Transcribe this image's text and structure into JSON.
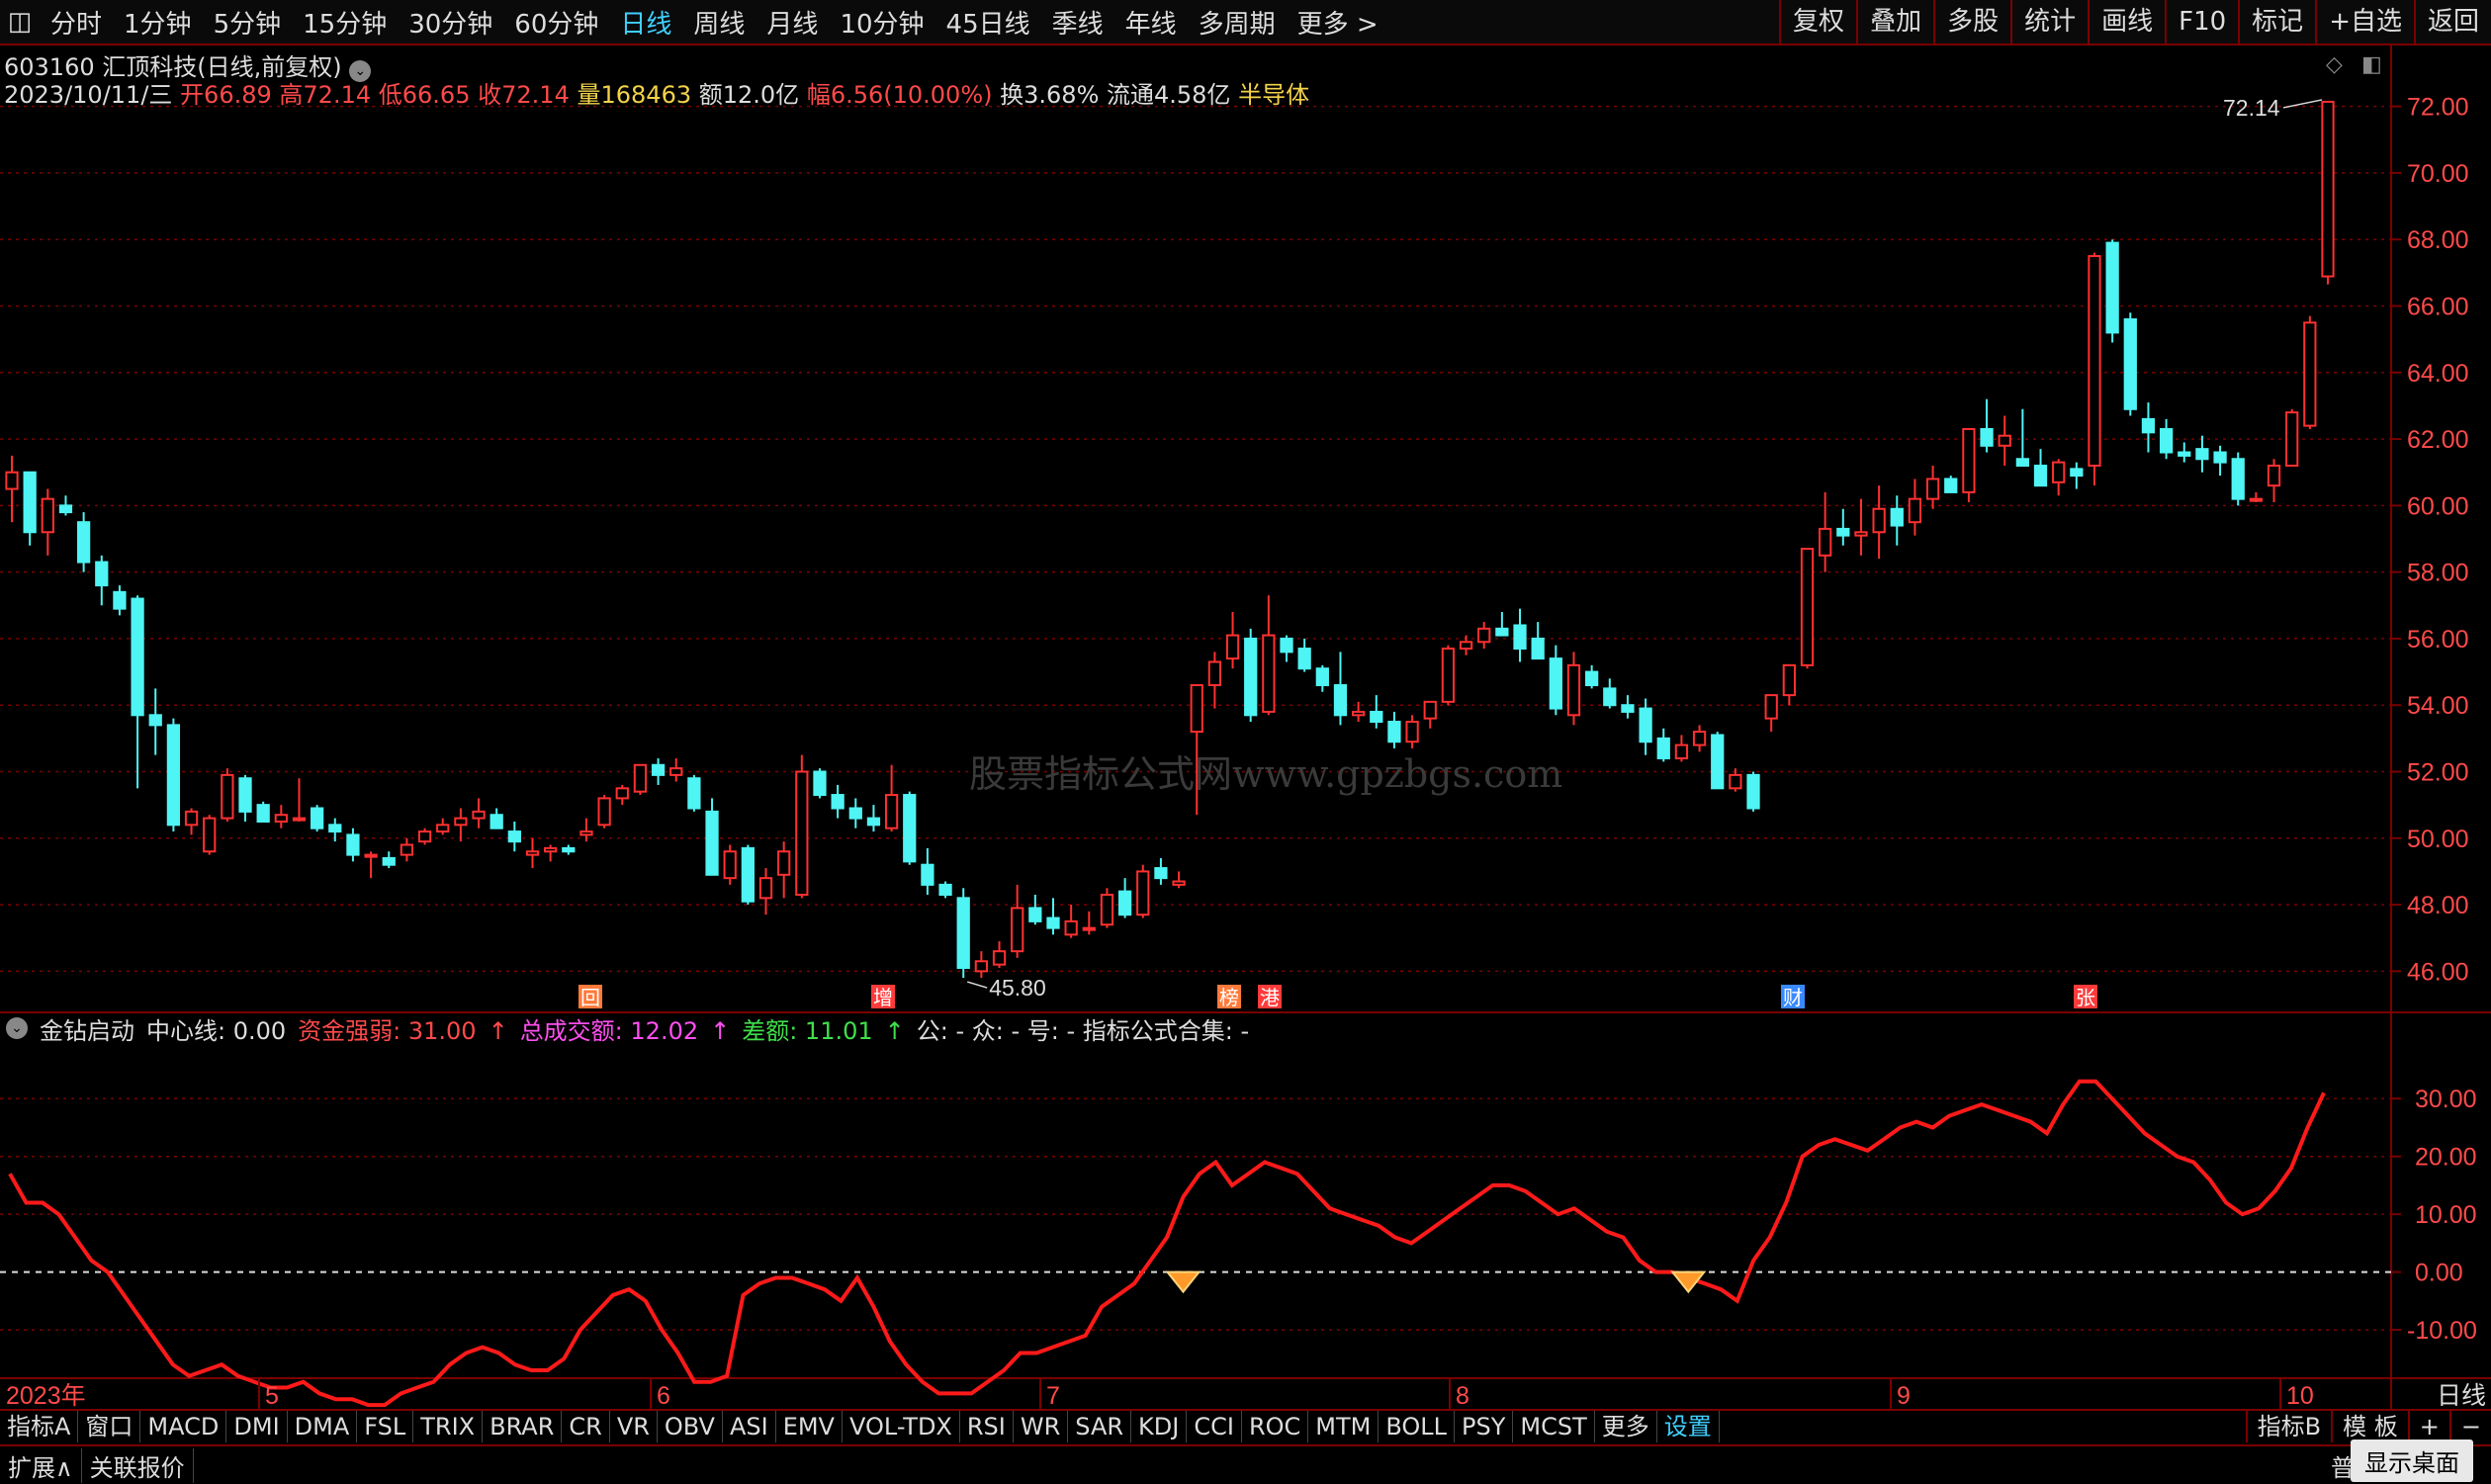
{
  "toolbar": {
    "tabs": [
      "分时",
      "1分钟",
      "5分钟",
      "15分钟",
      "30分钟",
      "60分钟",
      "日线",
      "周线",
      "月线",
      "10分钟",
      "45日线",
      "季线",
      "年线",
      "多周期",
      "更多 >"
    ],
    "active": "日线",
    "right": [
      "复权",
      "叠加",
      "多股",
      "统计",
      "画线",
      "F10",
      "标记",
      "+自选",
      "返回"
    ]
  },
  "stock": {
    "code_name": "603160 汇顶科技(日线,前复权)",
    "line2": [
      [
        "2023/10/11/三 ",
        "c-w"
      ],
      [
        "开",
        "c-r"
      ],
      [
        "66.89",
        "c-r"
      ],
      [
        " 高",
        "c-r"
      ],
      [
        "72.14",
        "c-r"
      ],
      [
        " 低",
        "c-r"
      ],
      [
        "66.65",
        "c-r"
      ],
      [
        " 收",
        "c-r"
      ],
      [
        "72.14",
        "c-r"
      ],
      [
        " 量",
        "c-y"
      ],
      [
        "168463",
        "c-y"
      ],
      [
        " 额12.0亿 ",
        "c-w"
      ],
      [
        "幅",
        "c-r"
      ],
      [
        "6.56(10.00%)",
        "c-r"
      ],
      [
        " 换3.68% 流通4.58亿 ",
        "c-w"
      ],
      [
        "半导体",
        "c-y"
      ]
    ]
  },
  "chart_data": {
    "type": "candlestick",
    "ylim": [
      45,
      73
    ],
    "yticks": [
      "72.00",
      "70.00",
      "68.00",
      "66.00",
      "64.00",
      "62.00",
      "60.00",
      "58.00",
      "56.00",
      "54.00",
      "52.00",
      "50.00",
      "48.00",
      "46.00"
    ],
    "max_label": "72.14",
    "min_label": "45.80",
    "months": [
      "2023年",
      "5",
      "6",
      "7",
      "8",
      "9",
      "10"
    ],
    "markers": [
      "回",
      "增",
      "榜",
      "港",
      "财",
      "张"
    ],
    "ohlc": [
      [
        60.5,
        61.5,
        59.5,
        61
      ],
      [
        61,
        61,
        58.8,
        59.2
      ],
      [
        59.2,
        60.5,
        58.5,
        60.2
      ],
      [
        60,
        60.3,
        59.7,
        59.8
      ],
      [
        59.5,
        59.8,
        58,
        58.3
      ],
      [
        58.3,
        58.5,
        57,
        57.6
      ],
      [
        57.4,
        57.6,
        56.7,
        56.9
      ],
      [
        57.2,
        57.3,
        51.5,
        53.7
      ],
      [
        53.7,
        54.5,
        52.5,
        53.4
      ],
      [
        53.4,
        53.6,
        50.2,
        50.4
      ],
      [
        50.4,
        50.9,
        50.1,
        50.8
      ],
      [
        49.6,
        50.7,
        49.5,
        50.6
      ],
      [
        50.6,
        52.1,
        50.5,
        51.9
      ],
      [
        51.8,
        51.9,
        50.5,
        50.8
      ],
      [
        51,
        51.1,
        50.6,
        50.5
      ],
      [
        50.5,
        51,
        50.3,
        50.7
      ],
      [
        50.6,
        51.8,
        50.5,
        50.6
      ],
      [
        50.9,
        51,
        50.2,
        50.3
      ],
      [
        50.4,
        50.6,
        49.9,
        50.2
      ],
      [
        50.1,
        50.3,
        49.3,
        49.5
      ],
      [
        49.5,
        49.6,
        48.8,
        49.5
      ],
      [
        49.4,
        49.6,
        49.1,
        49.2
      ],
      [
        49.5,
        50,
        49.3,
        49.8
      ],
      [
        49.9,
        50.3,
        49.8,
        50.2
      ],
      [
        50.2,
        50.6,
        50.1,
        50.4
      ],
      [
        50.4,
        50.9,
        49.9,
        50.6
      ],
      [
        50.6,
        51.2,
        50.3,
        50.8
      ],
      [
        50.7,
        50.9,
        50.3,
        50.3
      ],
      [
        50.2,
        50.5,
        49.6,
        49.9
      ],
      [
        49.5,
        50,
        49.1,
        49.6
      ],
      [
        49.6,
        49.8,
        49.3,
        49.7
      ],
      [
        49.7,
        49.8,
        49.5,
        49.6
      ],
      [
        50.1,
        50.6,
        49.9,
        50.2
      ],
      [
        50.4,
        51.3,
        50.3,
        51.2
      ],
      [
        51.2,
        51.6,
        51,
        51.5
      ],
      [
        51.4,
        52.2,
        51.3,
        52.2
      ],
      [
        52.2,
        52.4,
        51.6,
        51.9
      ],
      [
        51.9,
        52.4,
        51.7,
        52.1
      ],
      [
        51.8,
        51.9,
        50.8,
        50.9
      ],
      [
        50.8,
        51.2,
        48.9,
        48.9
      ],
      [
        48.8,
        49.8,
        48.6,
        49.6
      ],
      [
        49.7,
        49.8,
        48,
        48.1
      ],
      [
        48.2,
        49.1,
        47.7,
        48.8
      ],
      [
        48.9,
        49.9,
        48.2,
        49.6
      ],
      [
        48.3,
        52.5,
        48.2,
        52
      ],
      [
        52,
        52.1,
        51.2,
        51.3
      ],
      [
        51.3,
        51.6,
        50.6,
        50.9
      ],
      [
        50.9,
        51.2,
        50.3,
        50.6
      ],
      [
        50.6,
        51,
        50.2,
        50.4
      ],
      [
        50.3,
        52.2,
        50.2,
        51.3
      ],
      [
        51.3,
        51.4,
        49.2,
        49.3
      ],
      [
        49.2,
        49.7,
        48.3,
        48.6
      ],
      [
        48.6,
        48.7,
        48.2,
        48.3
      ],
      [
        48.2,
        48.5,
        45.8,
        46.1
      ],
      [
        46,
        46.6,
        45.8,
        46.3
      ],
      [
        46.2,
        46.9,
        46.1,
        46.6
      ],
      [
        46.6,
        48.6,
        46.4,
        47.9
      ],
      [
        47.9,
        48.3,
        47.4,
        47.5
      ],
      [
        47.6,
        48.2,
        47.1,
        47.3
      ],
      [
        47.1,
        48,
        47,
        47.5
      ],
      [
        47.3,
        47.8,
        47.1,
        47.3
      ],
      [
        47.4,
        48.5,
        47.3,
        48.3
      ],
      [
        48.4,
        48.8,
        47.6,
        47.7
      ],
      [
        47.7,
        49.2,
        47.6,
        49
      ],
      [
        49.1,
        49.4,
        48.6,
        48.8
      ],
      [
        48.6,
        49,
        48.5,
        48.7
      ],
      [
        53.2,
        54.5,
        50.7,
        54.6
      ],
      [
        54.6,
        55.6,
        53.9,
        55.3
      ],
      [
        55.4,
        56.8,
        55.1,
        56.1
      ],
      [
        56,
        56.3,
        53.5,
        53.7
      ],
      [
        53.8,
        57.3,
        53.7,
        56.1
      ],
      [
        56,
        56.1,
        55.3,
        55.6
      ],
      [
        55.7,
        56,
        55,
        55.1
      ],
      [
        55.1,
        55.2,
        54.4,
        54.6
      ],
      [
        54.6,
        55.6,
        53.4,
        53.7
      ],
      [
        53.7,
        54.1,
        53.5,
        53.8
      ],
      [
        53.8,
        54.3,
        53.3,
        53.5
      ],
      [
        53.5,
        53.8,
        52.7,
        52.9
      ],
      [
        52.9,
        53.7,
        52.7,
        53.5
      ],
      [
        53.6,
        54.1,
        53.3,
        54.1
      ],
      [
        54.1,
        55.8,
        54,
        55.7
      ],
      [
        55.7,
        56.1,
        55.5,
        55.9
      ],
      [
        55.9,
        56.5,
        55.7,
        56.3
      ],
      [
        56.3,
        56.8,
        56.1,
        56.1
      ],
      [
        56.4,
        56.9,
        55.3,
        55.7
      ],
      [
        56,
        56.5,
        55.8,
        55.4
      ],
      [
        55.4,
        55.8,
        53.7,
        53.9
      ],
      [
        53.7,
        55.6,
        53.4,
        55.2
      ],
      [
        55,
        55.2,
        54.5,
        54.6
      ],
      [
        54.5,
        54.8,
        53.9,
        54
      ],
      [
        54,
        54.3,
        53.6,
        53.8
      ],
      [
        53.9,
        54.2,
        52.5,
        52.9
      ],
      [
        53,
        53.3,
        52.3,
        52.4
      ],
      [
        52.4,
        53.1,
        52.3,
        52.8
      ],
      [
        52.8,
        53.4,
        52.6,
        53.2
      ],
      [
        53.1,
        53.2,
        51.5,
        51.5
      ],
      [
        51.5,
        52.1,
        51.4,
        51.9
      ],
      [
        51.9,
        52,
        50.8,
        50.9
      ],
      [
        53.6,
        54.3,
        53.2,
        54.3
      ],
      [
        54.3,
        55.2,
        54,
        55.2
      ],
      [
        55.2,
        58.2,
        55.1,
        58.7
      ],
      [
        58.5,
        60.4,
        58,
        59.3
      ],
      [
        59.3,
        59.9,
        58.8,
        59.1
      ],
      [
        59.1,
        60.2,
        58.5,
        59.2
      ],
      [
        59.2,
        60.6,
        58.4,
        59.9
      ],
      [
        59.9,
        60.3,
        58.8,
        59.4
      ],
      [
        59.5,
        60.8,
        59.1,
        60.2
      ],
      [
        60.2,
        61.2,
        59.9,
        60.8
      ],
      [
        60.8,
        60.9,
        60.4,
        60.4
      ],
      [
        60.4,
        62.3,
        60.1,
        62.3
      ],
      [
        62.3,
        63.2,
        61.6,
        61.8
      ],
      [
        61.8,
        62.7,
        61.2,
        62.1
      ],
      [
        61.4,
        62.9,
        61.2,
        61.2
      ],
      [
        61.2,
        61.7,
        60.8,
        60.6
      ],
      [
        60.7,
        61.4,
        60.3,
        61.3
      ],
      [
        61.1,
        61.3,
        60.5,
        60.9
      ],
      [
        61.2,
        67.6,
        60.6,
        67.5
      ],
      [
        67.9,
        68,
        64.9,
        65.2
      ],
      [
        65.6,
        65.8,
        62.7,
        62.9
      ],
      [
        62.6,
        63.1,
        61.6,
        62.2
      ],
      [
        62.3,
        62.6,
        61.4,
        61.6
      ],
      [
        61.6,
        61.9,
        61.3,
        61.5
      ],
      [
        61.7,
        62.1,
        61,
        61.4
      ],
      [
        61.6,
        61.8,
        60.9,
        61.3
      ],
      [
        61.4,
        61.6,
        60,
        60.2
      ],
      [
        60.2,
        60.4,
        60.1,
        60.2
      ],
      [
        60.6,
        61.4,
        60.1,
        61.2
      ],
      [
        61.2,
        62.9,
        61.2,
        62.8
      ],
      [
        62.4,
        65.7,
        62.3,
        65.5
      ],
      [
        66.89,
        72.14,
        66.65,
        72.14
      ]
    ],
    "indicator": {
      "name": "金钻启动",
      "center_label": "中心线: 0.00",
      "s1_label": "资金强弱: 31.00",
      "s2_label": "总成交额: 12.02",
      "s3_label": "差额: 11.01",
      "extra": "公: -  众: -  号: -  指标公式合集: -",
      "yticks": [
        "30.00",
        "20.00",
        "10.00",
        "0.00",
        "-10.00"
      ],
      "ylim": [
        -17,
        35
      ],
      "values": [
        17,
        12,
        12,
        10,
        6,
        2,
        0,
        -4,
        -8,
        -12,
        -16,
        -18,
        -17,
        -16,
        -18,
        -19,
        -20,
        -20,
        -19,
        -21,
        -22,
        -22,
        -23,
        -23,
        -21,
        -20,
        -19,
        -16,
        -14,
        -13,
        -14,
        -16,
        -17,
        -17,
        -15,
        -10,
        -7,
        -4,
        -3,
        -5,
        -10,
        -14,
        -19,
        -19,
        -18,
        -4,
        -2,
        -1,
        -1,
        -2,
        -3,
        -5,
        -1,
        -6,
        -12,
        -16,
        -19,
        -21,
        -21,
        -21,
        -19,
        -17,
        -14,
        -14,
        -13,
        -12,
        -11,
        -6,
        -4,
        -2,
        2,
        6,
        13,
        17,
        19,
        15,
        17,
        19,
        18,
        17,
        14,
        11,
        10,
        9,
        8,
        6,
        5,
        7,
        9,
        11,
        13,
        15,
        15,
        14,
        12,
        10,
        11,
        9,
        7,
        6,
        2,
        0,
        0,
        -1,
        -2,
        -3,
        -5,
        2,
        6,
        12,
        20,
        22,
        23,
        22,
        21,
        23,
        25,
        26,
        25,
        27,
        28,
        29,
        28,
        27,
        26,
        24,
        29,
        33,
        33,
        30,
        27,
        24,
        22,
        20,
        19,
        16,
        12,
        10,
        11,
        14,
        18,
        25,
        31
      ],
      "signals": [
        72,
        103
      ]
    }
  },
  "watermark": "股票指标公式网www.gpzbgs.com",
  "bottom_tabs": [
    "指标A",
    "窗口",
    "MACD",
    "DMI",
    "DMA",
    "FSL",
    "TRIX",
    "BRAR",
    "CR",
    "VR",
    "OBV",
    "ASI",
    "EMV",
    "VOL-TDX",
    "RSI",
    "WR",
    "SAR",
    "KDJ",
    "CCI",
    "ROC",
    "MTM",
    "BOLL",
    "PSY",
    "MCST",
    "更多",
    "设置"
  ],
  "bottom_right": [
    "指标B",
    "模 板",
    "+",
    "−"
  ],
  "status": [
    "扩展∧",
    "关联报价"
  ],
  "status_right": "普",
  "show_desktop": "显示桌面",
  "colors": {
    "up": "#ff3030",
    "down": "#4ff4f4",
    "grid": "#7a0000",
    "line": "#ff1a1a"
  }
}
